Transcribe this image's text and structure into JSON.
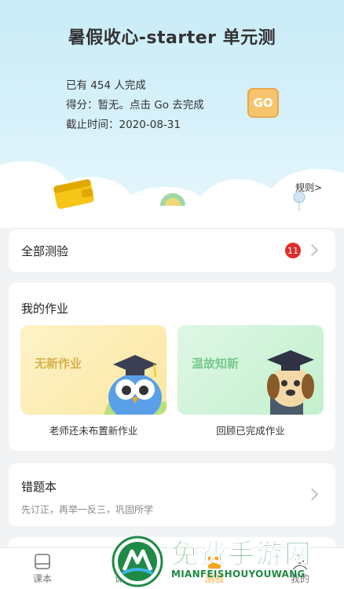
{
  "header": {
    "title": "暑假收心-starter 单元测",
    "completed_text": "已有 454 人完成",
    "score_text": "得分：暂无。点击 Go 去完成",
    "deadline_text": "截止时间：2020-08-31",
    "go_label": "GO",
    "rules_label": "规则>"
  },
  "all_tests": {
    "label": "全部测验",
    "badge_count": "11"
  },
  "homework": {
    "title": "我的作业",
    "tiles": [
      {
        "label": "无新作业",
        "caption": "老师还未布置新作业"
      },
      {
        "label": "温故知新",
        "caption": "回顾已完成作业"
      }
    ]
  },
  "mistakes": {
    "title": "错题本",
    "subtitle": "先订正，再举一反三，巩固所学"
  },
  "tabbar": {
    "tabs": [
      {
        "label": "课本"
      },
      {
        "label": "课堂"
      },
      {
        "label": "测验",
        "active": true
      },
      {
        "label": "我的"
      }
    ]
  },
  "watermark": {
    "title": "免费手游网",
    "url": "MIANFEISHOUYOUWANG"
  },
  "colors": {
    "accent": "#f6a623",
    "badge": "#e02d2d",
    "go_button": "#f6c46d"
  }
}
